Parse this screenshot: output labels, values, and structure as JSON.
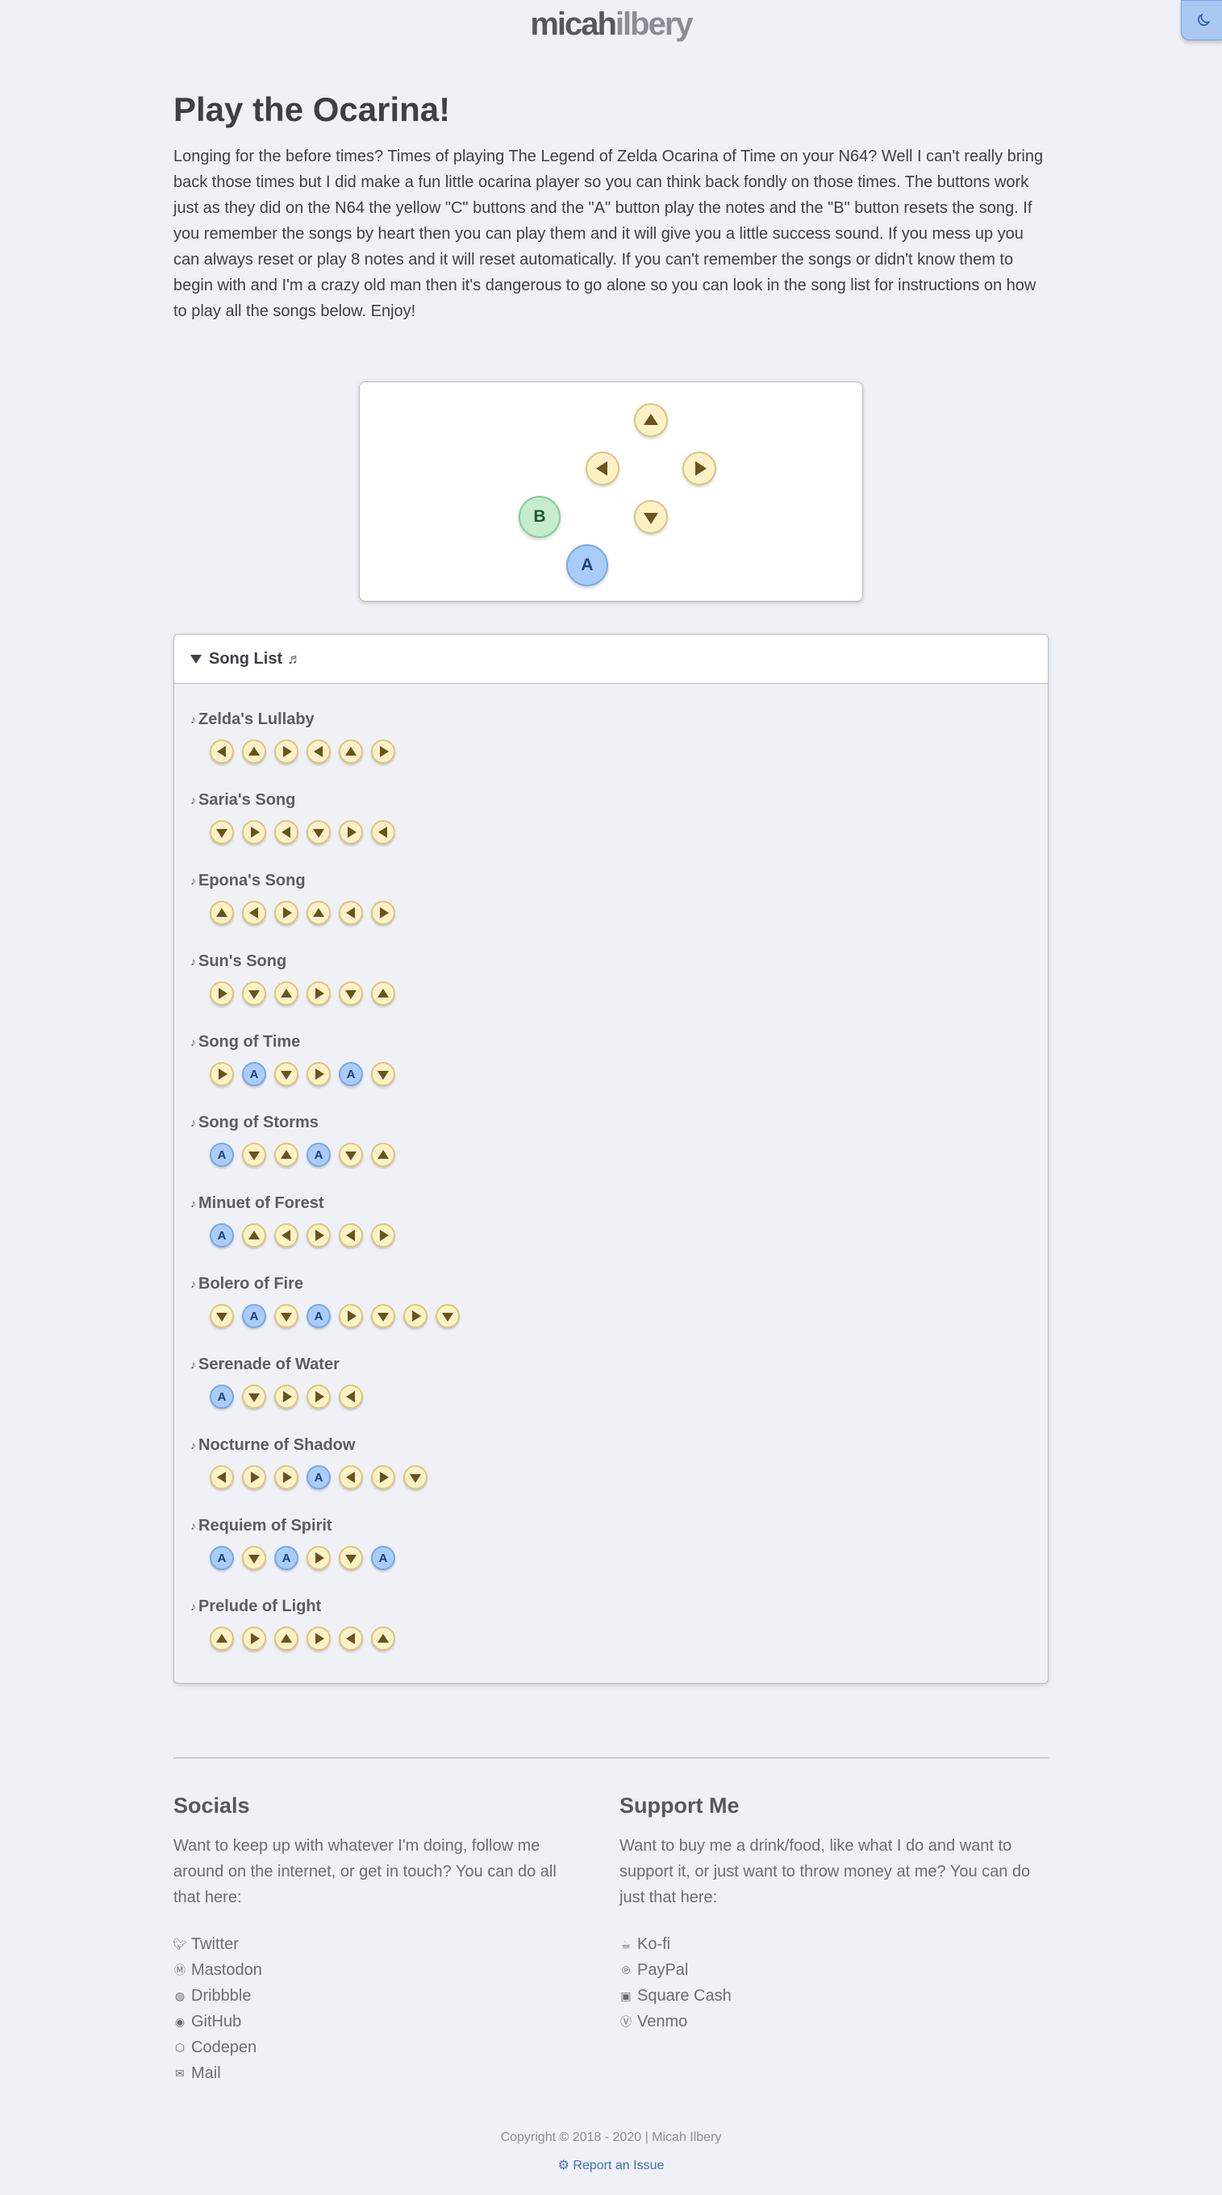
{
  "header": {
    "logo_bold": "micah",
    "logo_light": "ilbery"
  },
  "page": {
    "title": "Play the Ocarina!",
    "intro": "Longing for the before times? Times of playing The Legend of Zelda Ocarina of Time on your N64? Well I can't really bring back those times but I did make a fun little ocarina player so you can think back fondly on those times. The buttons work just as they did on the N64 the yellow \"C\" buttons and the \"A\" button play the notes and the \"B\" button resets the song. If you remember the songs by heart then you can play them and it will give you a little success sound. If you mess up you can always reset or play 8 notes and it will reset automatically. If you can't remember the songs or didn't know them to begin with and I'm a crazy old man then it's dangerous to go alone so you can look in the song list for instructions on how to play all the songs below. Enjoy!"
  },
  "player": {
    "buttons": {
      "a_label": "A",
      "b_label": "B"
    },
    "icons": [
      "c-up-icon",
      "c-left-icon",
      "c-right-icon",
      "c-down-icon"
    ]
  },
  "song_list": {
    "label": "Song List",
    "songs": [
      {
        "name": "Zelda's Lullaby",
        "notes": [
          "left",
          "up",
          "right",
          "left",
          "up",
          "right"
        ]
      },
      {
        "name": "Saria's Song",
        "notes": [
          "down",
          "right",
          "left",
          "down",
          "right",
          "left"
        ]
      },
      {
        "name": "Epona's Song",
        "notes": [
          "up",
          "left",
          "right",
          "up",
          "left",
          "right"
        ]
      },
      {
        "name": "Sun's Song",
        "notes": [
          "right",
          "down",
          "up",
          "right",
          "down",
          "up"
        ]
      },
      {
        "name": "Song of Time",
        "notes": [
          "right",
          "A",
          "down",
          "right",
          "A",
          "down"
        ]
      },
      {
        "name": "Song of Storms",
        "notes": [
          "A",
          "down",
          "up",
          "A",
          "down",
          "up"
        ]
      },
      {
        "name": "Minuet of Forest",
        "notes": [
          "A",
          "up",
          "left",
          "right",
          "left",
          "right"
        ]
      },
      {
        "name": "Bolero of Fire",
        "notes": [
          "down",
          "A",
          "down",
          "A",
          "right",
          "down",
          "right",
          "down"
        ]
      },
      {
        "name": "Serenade of Water",
        "notes": [
          "A",
          "down",
          "right",
          "right",
          "left"
        ]
      },
      {
        "name": "Nocturne of Shadow",
        "notes": [
          "left",
          "right",
          "right",
          "A",
          "left",
          "right",
          "down"
        ]
      },
      {
        "name": "Requiem of Spirit",
        "notes": [
          "A",
          "down",
          "A",
          "right",
          "down",
          "A"
        ]
      },
      {
        "name": "Prelude of Light",
        "notes": [
          "up",
          "right",
          "up",
          "right",
          "left",
          "up"
        ]
      }
    ]
  },
  "footer": {
    "socials": {
      "title": "Socials",
      "text": "Want to keep up with whatever I'm doing, follow me around on the internet, or get in touch? You can do all that here:",
      "links": [
        {
          "label": "Twitter",
          "icon": "twitter-icon"
        },
        {
          "label": "Mastodon",
          "icon": "mastodon-icon"
        },
        {
          "label": "Dribbble",
          "icon": "dribbble-icon"
        },
        {
          "label": "GitHub",
          "icon": "github-icon"
        },
        {
          "label": "Codepen",
          "icon": "codepen-icon"
        },
        {
          "label": "Mail",
          "icon": "mail-icon"
        }
      ]
    },
    "support": {
      "title": "Support Me",
      "text": "Want to buy me a drink/food, like what I do and want to support it, or just want to throw money at me? You can do just that here:",
      "links": [
        {
          "label": "Ko-fi",
          "icon": "kofi-icon"
        },
        {
          "label": "PayPal",
          "icon": "paypal-icon"
        },
        {
          "label": "Square Cash",
          "icon": "square-cash-icon"
        },
        {
          "label": "Venmo",
          "icon": "venmo-icon"
        }
      ]
    },
    "copyright": "Copyright © 2018 - 2020 | Micah Ilbery",
    "issue_link": "Report an Issue"
  },
  "colors": {
    "background": "#f0f1f6",
    "c_button": "#fdf2c6",
    "a_button": "#a9cdf8",
    "b_button": "#c5eccb",
    "link": "#3f6fc2"
  }
}
